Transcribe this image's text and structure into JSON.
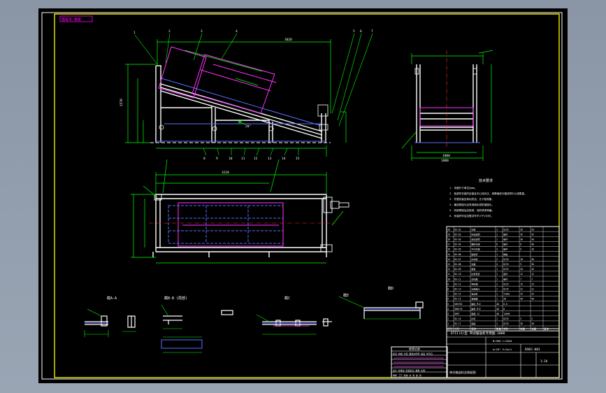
{
  "sheet": {
    "layer_tag": "图纸号 模板",
    "title_block_lines": [
      "DTII(A)型 带式输送机专用图-2008",
      "B=500  L=3020",
      "α=20°  V=1m/s"
    ],
    "drawing_number": "DXBJ-001",
    "product_name": "带式输送机总装配图",
    "scale": "1:20"
  },
  "notes": {
    "heading": "技术要求",
    "items": [
      "1. 本图尺寸单位为mm。",
      "2. 各部件安装时应保证中心线对正，滚筒轴线与输送带中心线垂直。",
      "3. 托辊安装应转动灵活，无卡阻现象。",
      "4. 输送带接头应采用硫化或机械接头。",
      "5. 机架焊接后应除锈，涂防锈漆两遍。",
      "6. 安装完毕后空载试车不少于2小时。"
    ]
  },
  "section_labels": [
    "截A-A",
    "截B-B (局部)",
    "截C",
    "截D",
    "截E"
  ],
  "part_numbers": [
    "1",
    "2",
    "3",
    "4",
    "5",
    "6",
    "7",
    "8",
    "9",
    "10",
    "11",
    "12",
    "13",
    "14",
    "15"
  ],
  "dimensions": {
    "top_length": "3020",
    "plan_length": "3220",
    "height": "1570",
    "width": "1000",
    "side_width": "1080",
    "angle": "20°"
  },
  "parts_table": {
    "header": [
      "序号",
      "代号",
      "名称",
      "数量",
      "材料",
      "单重",
      "总重",
      "备注"
    ],
    "rows": [
      [
        "20",
        "DX-01",
        "头架",
        "1",
        "Q235",
        "26",
        "26",
        ""
      ],
      [
        "19",
        "DX-02",
        "传动滚筒",
        "1",
        "组件",
        "45",
        "45",
        ""
      ],
      [
        "18",
        "DX-03",
        "改向滚筒",
        "1",
        "组件",
        "30",
        "30",
        ""
      ],
      [
        "17",
        "DX-04",
        "槽形托辊",
        "6",
        "组件",
        "8",
        "48",
        ""
      ],
      [
        "16",
        "DX-05",
        "平行托辊",
        "3",
        "组件",
        "6",
        "18",
        ""
      ],
      [
        "15",
        "DX-06",
        "输送带",
        "1",
        "橡胶",
        "",
        "",
        ""
      ],
      [
        "14",
        "DX-07",
        "中间架",
        "2",
        "Q235",
        "18",
        "36",
        ""
      ],
      [
        "13",
        "DX-08",
        "支腿",
        "4",
        "Q235",
        "9",
        "36",
        ""
      ],
      [
        "12",
        "DX-09",
        "尾架",
        "1",
        "Q235",
        "20",
        "20",
        ""
      ],
      [
        "11",
        "DX-10",
        "拉紧装置",
        "1",
        "组件",
        "12",
        "12",
        ""
      ],
      [
        "10",
        "DX-11",
        "清扫器",
        "1",
        "组件",
        "7",
        "7",
        ""
      ],
      [
        "9",
        "DX-12",
        "导料槽",
        "1",
        "Q235",
        "15",
        "15",
        ""
      ],
      [
        "8",
        "DX-13",
        "头部漏斗",
        "1",
        "Q235",
        "22",
        "22",
        ""
      ],
      [
        "7",
        "DX-14",
        "电动机",
        "1",
        "Y100L",
        "34",
        "34",
        ""
      ],
      [
        "6",
        "DX-15",
        "减速器",
        "1",
        "ZQ",
        "40",
        "40",
        ""
      ],
      [
        "5",
        "GB5782",
        "螺栓 M12",
        "48",
        "8.8",
        "",
        "",
        ""
      ],
      [
        "4",
        "GB6170",
        "螺母 M12",
        "48",
        "8",
        "",
        "",
        ""
      ],
      [
        "3",
        "GB97",
        "垫圈 12",
        "48",
        "140HV",
        "",
        "",
        ""
      ],
      [
        "2",
        "DX-16",
        "护罩",
        "1",
        "Q235",
        "5",
        "5",
        ""
      ],
      [
        "1",
        "DX-17",
        "底座",
        "1",
        "Q235",
        "28",
        "28",
        ""
      ]
    ]
  },
  "revision_block": {
    "heading": "修改记录",
    "lines": [
      "标记 处数 分区 更改文件号 签名 年月日",
      "设计 标准化 阶段标记 重量 比例",
      "审核 工艺 批准 共 张 第 张"
    ]
  }
}
